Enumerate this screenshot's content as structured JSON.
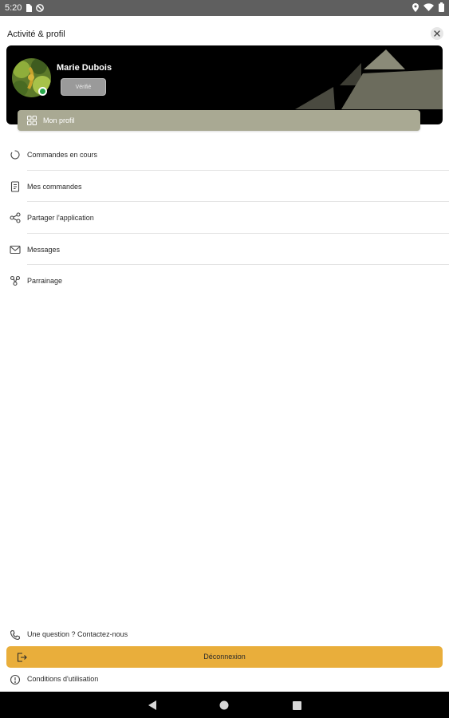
{
  "status_bar": {
    "time": "5:20",
    "icons": [
      "sim-card-icon",
      "no-disturb-icon",
      "location-icon",
      "wifi-icon",
      "battery-icon"
    ]
  },
  "header": {
    "title": "Activité & profil",
    "close_icon": "close-icon"
  },
  "profile": {
    "name": "Marie Dubois",
    "verify_label": "Vérifié",
    "online": true,
    "profile_button_label": "Mon profil"
  },
  "menu": {
    "items": [
      {
        "icon": "spinner-icon",
        "label": "Commandes en cours"
      },
      {
        "icon": "receipt-icon",
        "label": "Mes commandes"
      },
      {
        "icon": "share-icon",
        "label": "Partager l'application"
      },
      {
        "icon": "mail-icon",
        "label": "Messages"
      },
      {
        "icon": "referral-icon",
        "label": "Parrainage"
      }
    ]
  },
  "footer": {
    "contact_label": "Une question ? Contactez-nous",
    "logout_label": "Déconnexion",
    "terms_label": "Conditions d'utilisation"
  },
  "colors": {
    "accent": "#e9ae3b",
    "profile_bar": "#a9a993",
    "card_bg": "#000000",
    "online": "#27a84a"
  }
}
